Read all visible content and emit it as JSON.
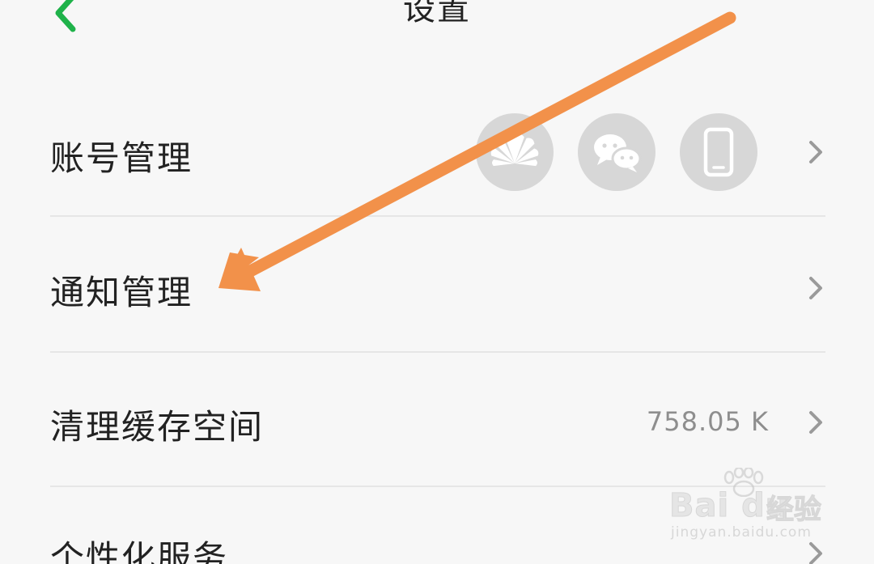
{
  "header": {
    "title": "设置",
    "back_icon": "chevron-left-icon",
    "accent_color": "#1fb24a"
  },
  "settings": {
    "account": {
      "label": "账号管理",
      "bound_icons": [
        "huawei-logo-icon",
        "wechat-icon",
        "phone-icon"
      ]
    },
    "notifications": {
      "label": "通知管理"
    },
    "cache": {
      "label": "清理缓存空间",
      "value": "758.05 K"
    },
    "personalization": {
      "label": "个性化服务"
    }
  },
  "annotation": {
    "arrow_color": "#f2914a"
  },
  "watermark": {
    "brand": "Bai du",
    "name": "经验",
    "url": "jingyan.baidu.com"
  }
}
